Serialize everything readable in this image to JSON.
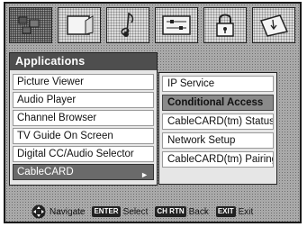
{
  "applications": {
    "title": "Applications",
    "items": [
      {
        "label": "Picture Viewer"
      },
      {
        "label": "Audio Player"
      },
      {
        "label": "Channel Browser"
      },
      {
        "label": "TV Guide On Screen"
      },
      {
        "label": "Digital CC/Audio Selector"
      },
      {
        "label": "CableCARD"
      }
    ],
    "selected_index": 5
  },
  "submenu": {
    "items": [
      {
        "label": "IP Service"
      },
      {
        "label": "Conditional Access"
      },
      {
        "label": "CableCARD(tm) Status"
      },
      {
        "label": "Network Setup"
      },
      {
        "label": "CableCARD(tm) Pairing"
      }
    ],
    "highlighted_index": 1
  },
  "top_icons": [
    {
      "name": "applications-icon",
      "active": true
    },
    {
      "name": "picture-icon",
      "active": false
    },
    {
      "name": "sound-icon",
      "active": false
    },
    {
      "name": "settings-icon",
      "active": false
    },
    {
      "name": "lock-icon",
      "active": false
    },
    {
      "name": "guide-icon",
      "active": false
    }
  ],
  "nav_bar": {
    "navigate_label": "Navigate",
    "enter_key": "ENTER",
    "select_label": "Select",
    "back_key": "CH RTN",
    "back_label": "Back",
    "exit_key": "EXIT",
    "exit_label": "Exit"
  },
  "colors": {
    "title_bar": "#4e4e4e",
    "selected_item": "#6a6a6a",
    "highlighted_item": "#8a8a8a"
  }
}
